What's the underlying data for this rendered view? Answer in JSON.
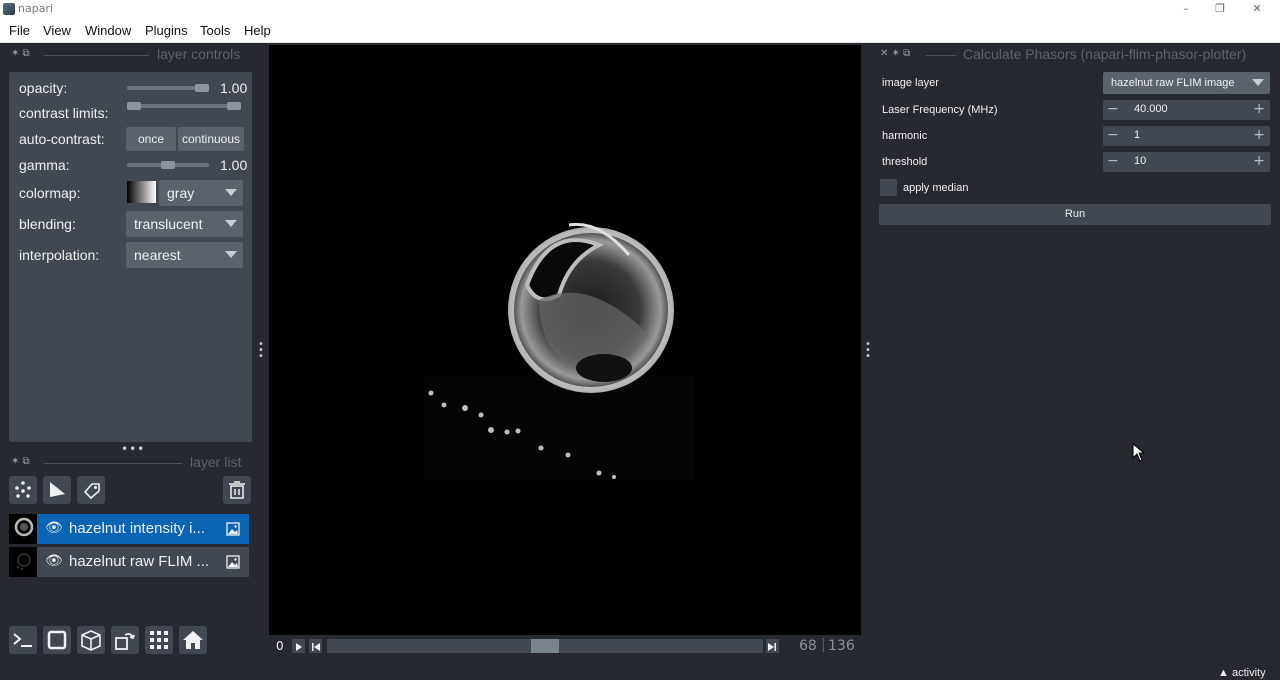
{
  "window": {
    "title": "napari",
    "minimize": "–",
    "restore": "❐",
    "close": "✕"
  },
  "menu": [
    "File",
    "View",
    "Window",
    "Plugins",
    "Tools",
    "Help"
  ],
  "layer_controls": {
    "dock_title": "layer controls",
    "opacity_label": "opacity:",
    "opacity_value": "1.00",
    "opacity_level": 1.0,
    "contrast_label": "contrast limits:",
    "contrast_range": [
      0.0,
      1.0
    ],
    "autocontrast_label": "auto-contrast:",
    "once_label": "once",
    "continuous_label": "continuous",
    "gamma_label": "gamma:",
    "gamma_value": "1.00",
    "gamma_level": 0.5,
    "colormap_label": "colormap:",
    "colormap_value": "gray",
    "blending_label": "blending:",
    "blending_value": "translucent",
    "interpolation_label": "interpolation:",
    "interpolation_value": "nearest"
  },
  "layer_list": {
    "dock_title": "layer list",
    "layers": [
      {
        "name": "hazelnut intensity i...",
        "selected": true,
        "visible": true,
        "icon": "image-icon"
      },
      {
        "name": "hazelnut raw FLIM ...",
        "selected": false,
        "visible": true,
        "icon": "image-icon"
      }
    ]
  },
  "dims": {
    "start": "0",
    "current": "68",
    "total": "136",
    "position_fraction": 0.5
  },
  "plugin": {
    "dock_title": "Calculate Phasors (napari-flim-phasor-plotter)",
    "image_layer_label": "image layer",
    "image_layer_value": "hazelnut raw FLIM image",
    "laser_label": "Laser Frequency (MHz)",
    "laser_value": "40.000",
    "harmonic_label": "harmonic",
    "harmonic_value": "1",
    "threshold_label": "threshold",
    "threshold_value": "10",
    "apply_median_label": "apply median",
    "apply_median_checked": false,
    "run_label": "Run"
  },
  "status": {
    "activity_label": "activity"
  },
  "colors": {
    "background": "#262930",
    "panel": "#414851",
    "selected": "#0a64b3",
    "button": "#5a626c"
  }
}
